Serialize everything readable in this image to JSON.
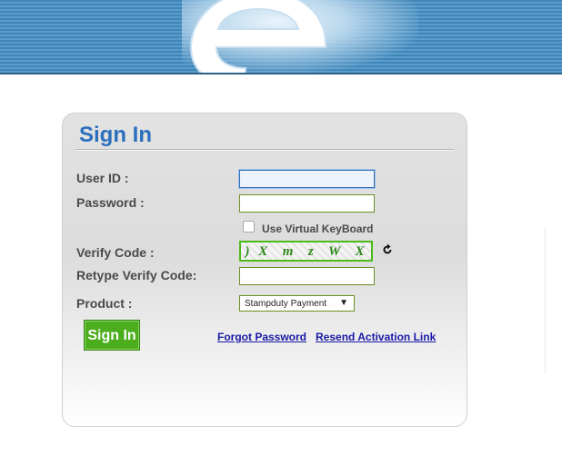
{
  "signin": {
    "title": "Sign In",
    "user_id_label": "User ID :",
    "password_label": "Password :",
    "virtual_keyboard_label": "Use Virtual KeyBoard",
    "verify_code_label": "Verify Code :",
    "retype_verify_label": "Retype Verify Code:",
    "product_label": "Product :",
    "captcha_text": ") X  m  z  W  X",
    "product_selected": "Stampduty Payment",
    "sign_in_button": "Sign In",
    "forgot_password_link": "Forgot Password",
    "resend_activation_link": "Resend Activation Link"
  },
  "colors": {
    "title": "#2c6fbd",
    "button": "#4cae1c",
    "link": "#1a1aa6"
  }
}
